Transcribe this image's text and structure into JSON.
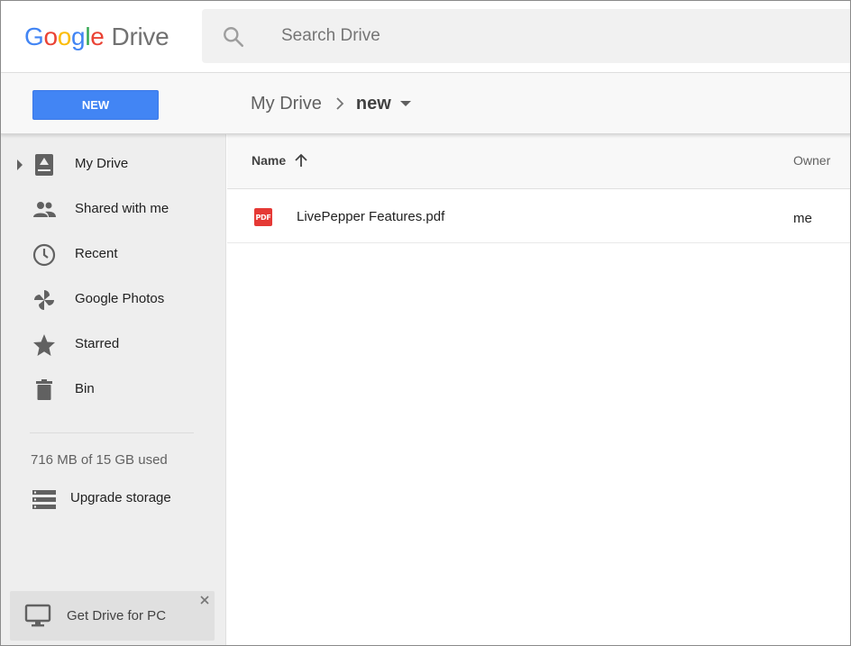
{
  "header": {
    "logo_product": "Drive",
    "logo_letters": [
      "G",
      "o",
      "o",
      "g",
      "l",
      "e"
    ],
    "logo_colors": [
      "#4285f4",
      "#ea4335",
      "#fbbc05",
      "#4285f4",
      "#34a853",
      "#ea4335"
    ],
    "search_placeholder": "Search Drive"
  },
  "toolbar": {
    "new_label": "NEW",
    "breadcrumb_root": "My Drive",
    "breadcrumb_current": "new"
  },
  "sidebar": {
    "items": [
      {
        "label": "My Drive",
        "icon": "drive-icon"
      },
      {
        "label": "Shared with me",
        "icon": "people-icon"
      },
      {
        "label": "Recent",
        "icon": "clock-icon"
      },
      {
        "label": "Google Photos",
        "icon": "photos-pinwheel-icon"
      },
      {
        "label": "Starred",
        "icon": "star-icon"
      },
      {
        "label": "Bin",
        "icon": "trash-icon"
      }
    ],
    "storage_text": "716 MB of 15 GB used",
    "upgrade_label": "Upgrade storage",
    "promo_label": "Get Drive for PC"
  },
  "list": {
    "columns": {
      "name": "Name",
      "owner": "Owner"
    },
    "files": [
      {
        "name": "LivePepper Features.pdf",
        "owner": "me",
        "type_badge": "PDF"
      }
    ]
  },
  "colors": {
    "accent": "#4285f4",
    "pdf": "#e53935",
    "sidebar_bg": "#eeeeee"
  }
}
